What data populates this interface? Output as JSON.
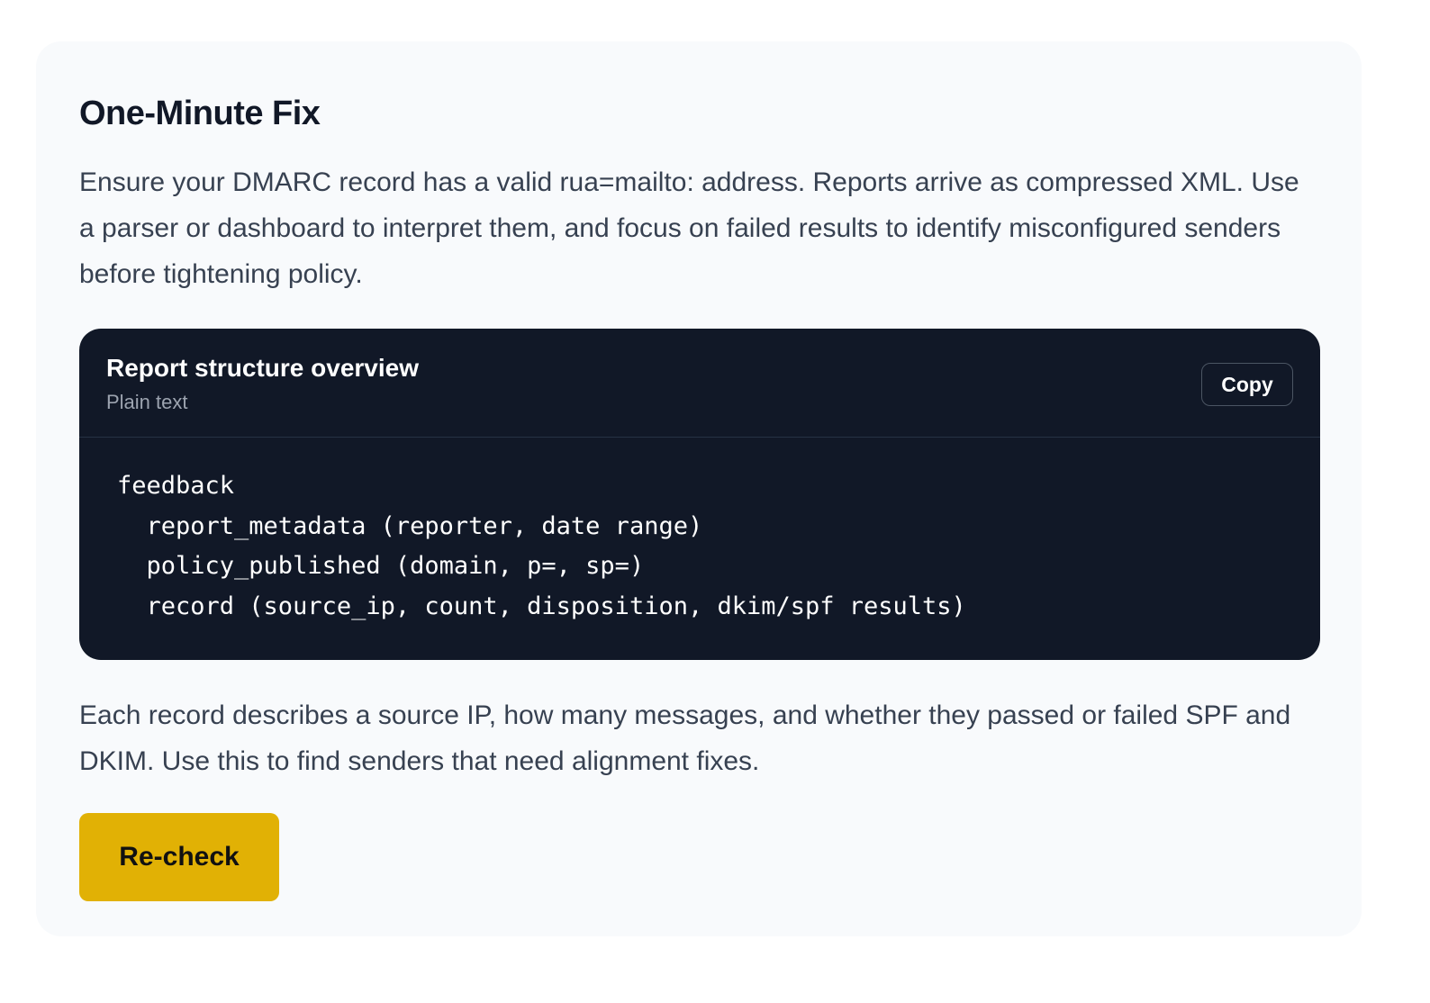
{
  "section": {
    "title": "One-Minute Fix",
    "intro": "Ensure your DMARC record has a valid rua=mailto: address. Reports arrive as compressed XML. Use a parser or dashboard to interpret them, and focus on failed results to identify misconfigured senders before tightening policy.",
    "outro": "Each record describes a source IP, how many messages, and whether they passed or failed SPF and DKIM. Use this to find senders that need alignment fixes."
  },
  "code_block": {
    "title": "Report structure overview",
    "language": "Plain text",
    "copy_label": "Copy",
    "lines": [
      "feedback",
      "  report_metadata (reporter, date range)",
      "  policy_published (domain, p=, sp=)",
      "  record (source_ip, count, disposition, dkim/spf results)"
    ]
  },
  "actions": {
    "recheck_label": "Re-check"
  },
  "colors": {
    "card_background": "#f8fafc",
    "code_background": "#111827",
    "accent_button": "#e1b105"
  }
}
